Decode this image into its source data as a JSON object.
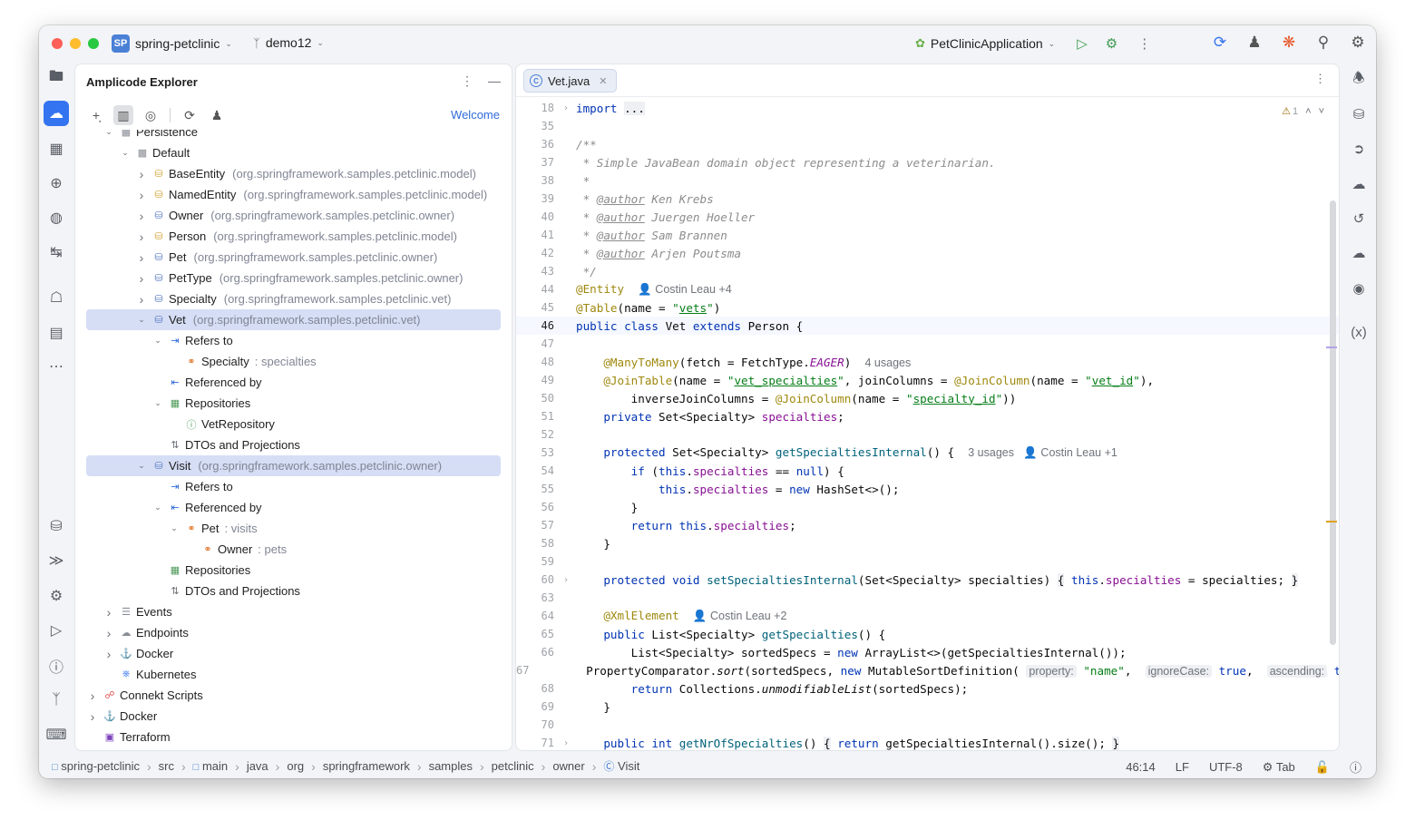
{
  "titlebar": {
    "project_badge": "SP",
    "project_name": "spring-petclinic",
    "branch": "demo12",
    "run_config": "PetClinicApplication"
  },
  "explorer": {
    "title": "Amplicode Explorer",
    "welcome_link": "Welcome",
    "tree": [
      {
        "label": "Persistence",
        "pkg": "",
        "indent": 1,
        "arrow": "down",
        "icon": "persistence-icon"
      },
      {
        "label": "Default",
        "pkg": "",
        "indent": 2,
        "arrow": "down",
        "icon": "datasource-icon"
      },
      {
        "label": "BaseEntity",
        "pkg": "(org.springframework.samples.petclinic.model)",
        "indent": 3,
        "arrow": "right",
        "icon": "mapped-superclass-icon"
      },
      {
        "label": "NamedEntity",
        "pkg": "(org.springframework.samples.petclinic.model)",
        "indent": 3,
        "arrow": "right",
        "icon": "mapped-superclass-icon"
      },
      {
        "label": "Owner",
        "pkg": "(org.springframework.samples.petclinic.owner)",
        "indent": 3,
        "arrow": "right",
        "icon": "entity-icon"
      },
      {
        "label": "Person",
        "pkg": "(org.springframework.samples.petclinic.model)",
        "indent": 3,
        "arrow": "right",
        "icon": "mapped-superclass-icon"
      },
      {
        "label": "Pet",
        "pkg": "(org.springframework.samples.petclinic.owner)",
        "indent": 3,
        "arrow": "right",
        "icon": "entity-icon"
      },
      {
        "label": "PetType",
        "pkg": "(org.springframework.samples.petclinic.owner)",
        "indent": 3,
        "arrow": "right",
        "icon": "entity-icon"
      },
      {
        "label": "Specialty",
        "pkg": "(org.springframework.samples.petclinic.vet)",
        "indent": 3,
        "arrow": "right",
        "icon": "entity-icon"
      },
      {
        "label": "Vet",
        "pkg": "(org.springframework.samples.petclinic.vet)",
        "indent": 3,
        "arrow": "down",
        "icon": "entity-icon",
        "selected": true
      },
      {
        "label": "Refers to",
        "pkg": "",
        "indent": 4,
        "arrow": "down",
        "icon": "refers-to-icon"
      },
      {
        "label": "Specialty",
        "sub": ": specialties",
        "pkg": "",
        "indent": 5,
        "arrow": "",
        "icon": "association-icon"
      },
      {
        "label": "Referenced by",
        "pkg": "",
        "indent": 4,
        "arrow": "",
        "icon": "referenced-by-icon"
      },
      {
        "label": "Repositories",
        "pkg": "",
        "indent": 4,
        "arrow": "down",
        "icon": "repositories-icon"
      },
      {
        "label": "VetRepository",
        "pkg": "",
        "indent": 5,
        "arrow": "",
        "icon": "interface-icon"
      },
      {
        "label": "DTOs and Projections",
        "pkg": "",
        "indent": 4,
        "arrow": "",
        "icon": "dto-icon"
      },
      {
        "label": "Visit",
        "pkg": "(org.springframework.samples.petclinic.owner)",
        "indent": 3,
        "arrow": "down",
        "icon": "entity-icon",
        "selected": true
      },
      {
        "label": "Refers to",
        "pkg": "",
        "indent": 4,
        "arrow": "",
        "icon": "refers-to-icon"
      },
      {
        "label": "Referenced by",
        "pkg": "",
        "indent": 4,
        "arrow": "down",
        "icon": "referenced-by-icon"
      },
      {
        "label": "Pet",
        "sub": ": visits",
        "pkg": "",
        "indent": 5,
        "arrow": "down",
        "icon": "association-icon"
      },
      {
        "label": "Owner",
        "sub": ": pets",
        "pkg": "",
        "indent": 6,
        "arrow": "",
        "icon": "association-icon"
      },
      {
        "label": "Repositories",
        "pkg": "",
        "indent": 4,
        "arrow": "",
        "icon": "repositories-icon"
      },
      {
        "label": "DTOs and Projections",
        "pkg": "",
        "indent": 4,
        "arrow": "",
        "icon": "dto-icon"
      },
      {
        "label": "Events",
        "pkg": "",
        "indent": 1,
        "arrow": "right",
        "icon": "events-icon"
      },
      {
        "label": "Endpoints",
        "pkg": "",
        "indent": 1,
        "arrow": "right",
        "icon": "endpoints-icon"
      },
      {
        "label": "Docker",
        "pkg": "",
        "indent": 1,
        "arrow": "right",
        "icon": "docker-icon"
      },
      {
        "label": "Kubernetes",
        "pkg": "",
        "indent": 1,
        "arrow": "",
        "icon": "kubernetes-icon"
      },
      {
        "label": "Connekt Scripts",
        "pkg": "",
        "indent": 0,
        "arrow": "right",
        "icon": "connekt-icon"
      },
      {
        "label": "Docker",
        "pkg": "",
        "indent": 0,
        "arrow": "right",
        "icon": "docker-icon"
      },
      {
        "label": "Terraform",
        "pkg": "",
        "indent": 0,
        "arrow": "",
        "icon": "terraform-icon"
      }
    ]
  },
  "editor": {
    "tab_label": "Vet.java",
    "warning_count": "1",
    "lines": [
      {
        "n": "18",
        "fold": "›",
        "html": "<span class='kw'>import</span> <span style='background:#eef0f3'>...</span>"
      },
      {
        "n": "35",
        "fold": "",
        "html": ""
      },
      {
        "n": "36",
        "fold": "",
        "html": "<span class='cm'>/**</span>"
      },
      {
        "n": "37",
        "fold": "",
        "html": "<span class='cm'> * Simple JavaBean domain object representing a veterinarian.</span>"
      },
      {
        "n": "38",
        "fold": "",
        "html": "<span class='cm'> *</span>"
      },
      {
        "n": "39",
        "fold": "",
        "html": "<span class='cm'> * <span class='under'>@author</span> Ken Krebs</span>"
      },
      {
        "n": "40",
        "fold": "",
        "html": "<span class='cm'> * <span class='under'>@author</span> Juergen Hoeller</span>"
      },
      {
        "n": "41",
        "fold": "",
        "html": "<span class='cm'> * <span class='under'>@author</span> Sam Brannen</span>"
      },
      {
        "n": "42",
        "fold": "",
        "html": "<span class='cm'> * <span class='under'>@author</span> Arjen Poutsma</span>"
      },
      {
        "n": "43",
        "fold": "",
        "html": "<span class='cm'> */</span>"
      },
      {
        "n": "44",
        "fold": "",
        "html": "<span class='ann'>@Entity</span>  <span class='hint'>&#128100; Costin Leau +4</span>"
      },
      {
        "n": "45",
        "fold": "",
        "html": "<span class='ann'>@Table</span>(name = <span class='str'>\"<span class='under'>vets</span>\"</span>)"
      },
      {
        "n": "46",
        "fold": "",
        "html": "<span class='kw'>public class</span> Vet <span class='kw'>extends</span> Person {",
        "cur": true
      },
      {
        "n": "47",
        "fold": "",
        "html": ""
      },
      {
        "n": "48",
        "fold": "",
        "html": "    <span class='ann'>@ManyToMany</span>(fetch = FetchType.<span class='fld ital'>EAGER</span>)  <span class='hint'>4 usages</span>"
      },
      {
        "n": "49",
        "fold": "",
        "html": "    <span class='ann'>@JoinTable</span>(name = <span class='str'>\"<span class='under'>vet_specialties</span>\"</span>, joinColumns = <span class='ann'>@JoinColumn</span>(name = <span class='str'>\"<span class='under'>vet_id</span>\"</span>),"
      },
      {
        "n": "50",
        "fold": "",
        "html": "        inverseJoinColumns = <span class='ann'>@JoinColumn</span>(name = <span class='str'>\"<span class='under'>specialty_id</span>\"</span>))"
      },
      {
        "n": "51",
        "fold": "",
        "html": "    <span class='kw'>private</span> Set&lt;Specialty&gt; <span class='fld'>specialties</span>;"
      },
      {
        "n": "52",
        "fold": "",
        "html": ""
      },
      {
        "n": "53",
        "fold": "",
        "html": "    <span class='kw'>protected</span> Set&lt;Specialty&gt; <span class='meth'>getSpecialtiesInternal</span>() {  <span class='hint'>3 usages   &#128100; Costin Leau +1</span>"
      },
      {
        "n": "54",
        "fold": "",
        "html": "        <span class='kw'>if</span> (<span class='kw'>this</span>.<span class='fld'>specialties</span> == <span class='kw'>null</span>) {"
      },
      {
        "n": "55",
        "fold": "",
        "html": "            <span class='kw'>this</span>.<span class='fld'>specialties</span> = <span class='kw'>new</span> HashSet&lt;&gt;();"
      },
      {
        "n": "56",
        "fold": "",
        "html": "        }"
      },
      {
        "n": "57",
        "fold": "",
        "html": "        <span class='kw'>return this</span>.<span class='fld'>specialties</span>;"
      },
      {
        "n": "58",
        "fold": "",
        "html": "    }"
      },
      {
        "n": "59",
        "fold": "",
        "html": ""
      },
      {
        "n": "60",
        "fold": "›",
        "html": "    <span class='kw'>protected void</span> <span class='meth'>setSpecialtiesInternal</span>(Set&lt;Specialty&gt; specialties) <span style='background:#eef0f3'>{</span> <span class='kw'>this</span>.<span class='fld'>specialties</span> = specialties; <span style='background:#eef0f3'>}</span>"
      },
      {
        "n": "63",
        "fold": "",
        "html": ""
      },
      {
        "n": "64",
        "fold": "",
        "html": "    <span class='ann'>@XmlElement</span>  <span class='hint'>&#128100; Costin Leau +2</span>"
      },
      {
        "n": "65",
        "fold": "",
        "html": "    <span class='kw'>public</span> List&lt;Specialty&gt; <span class='meth'>getSpecialties</span>() {"
      },
      {
        "n": "66",
        "fold": "",
        "html": "        List&lt;Specialty&gt; sortedSpecs = <span class='kw'>new</span> ArrayList&lt;&gt;(getSpecialtiesInternal());"
      },
      {
        "n": "67",
        "fold": "",
        "html": "        PropertyComparator.<span class='ital'>sort</span>(sortedSpecs, <span class='kw'>new</span> MutableSortDefinition( <span class='inlay'>property:</span> <span class='str'>\"name\"</span>,  <span class='inlay'>ignoreCase:</span> <span class='kw'>true</span>,  <span class='inlay'>ascending:</span> <span class='kw'>true</span>"
      },
      {
        "n": "68",
        "fold": "",
        "html": "        <span class='kw'>return</span> Collections.<span class='ital'>unmodifiableList</span>(sortedSpecs);"
      },
      {
        "n": "69",
        "fold": "",
        "html": "    }"
      },
      {
        "n": "70",
        "fold": "",
        "html": ""
      },
      {
        "n": "71",
        "fold": "›",
        "html": "    <span class='kw'>public int</span> <span class='meth'>getNrOfSpecialties</span>() <span style='background:#eef0f3'>{</span> <span class='kw'>return</span> getSpecialtiesInternal().size(); <span style='background:#eef0f3'>}</span>"
      }
    ]
  },
  "statusbar": {
    "breadcrumbs": [
      "spring-petclinic",
      "src",
      "main",
      "java",
      "org",
      "springframework",
      "samples",
      "petclinic",
      "owner",
      "Visit"
    ],
    "position": "46:14",
    "line_sep": "LF",
    "encoding": "UTF-8",
    "indent": "Tab"
  }
}
